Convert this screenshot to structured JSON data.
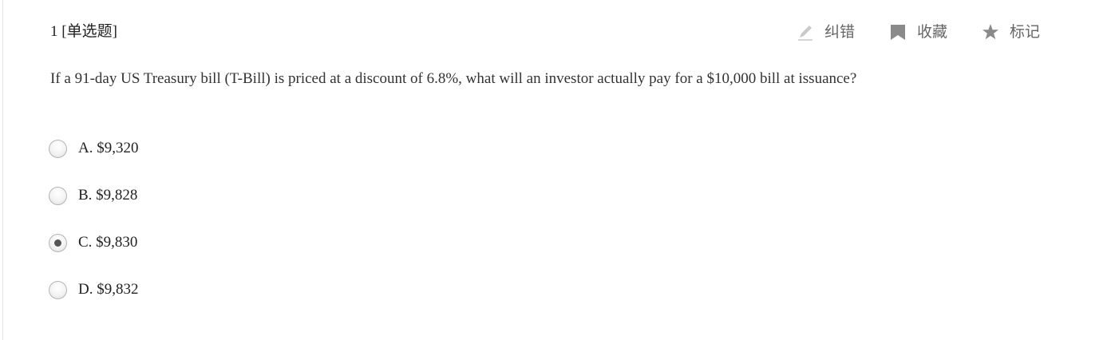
{
  "question": {
    "number_label": "1 [单选题]",
    "text": "If a 91-day US Treasury bill (T-Bill) is priced at a discount of 6.8%, what will an investor actually pay for a $10,000 bill at issuance?"
  },
  "actions": [
    {
      "label": "纠错",
      "icon": "pencil-icon"
    },
    {
      "label": "收藏",
      "icon": "bookmark-icon"
    },
    {
      "label": "标记",
      "icon": "star-icon"
    }
  ],
  "options": [
    {
      "label": "A. $9,320",
      "selected": false
    },
    {
      "label": "B. $9,828",
      "selected": false
    },
    {
      "label": "C. $9,830",
      "selected": true
    },
    {
      "label": "D. $9,832",
      "selected": false
    }
  ],
  "colors": {
    "text": "#222222",
    "action_text": "#666666",
    "icon": "#8a8a8a",
    "icon_light": "#c9c9c9"
  }
}
